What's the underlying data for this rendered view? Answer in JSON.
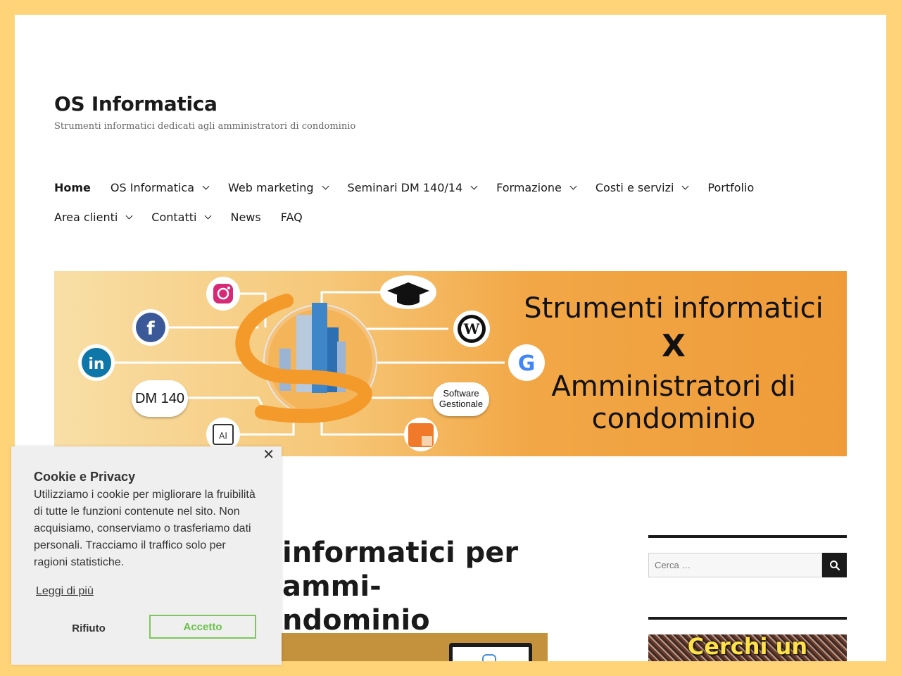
{
  "site": {
    "title": "OS Informatica",
    "description": "Strumenti informatici dedicati agli amministratori di condominio"
  },
  "menu": {
    "row1": [
      {
        "label": "Home",
        "current": true,
        "dropdown": false
      },
      {
        "label": "OS Informatica",
        "dropdown": true
      },
      {
        "label": "Web marketing",
        "dropdown": true
      },
      {
        "label": "Seminari DM 140/14",
        "dropdown": true
      },
      {
        "label": "Formazione",
        "dropdown": true
      },
      {
        "label": "Costi e servizi",
        "dropdown": true
      },
      {
        "label": "Portfolio",
        "dropdown": false
      }
    ],
    "row2": [
      {
        "label": "Area clienti",
        "dropdown": true
      },
      {
        "label": "Contatti",
        "dropdown": true
      },
      {
        "label": "News",
        "dropdown": false
      },
      {
        "label": "FAQ",
        "dropdown": false
      }
    ]
  },
  "banner": {
    "line1": "Strumenti informatici",
    "x": "X",
    "line2": "Amministratori di condominio",
    "bubble_dm": "DM 140",
    "bubble_software_1": "Software",
    "bubble_software_2": "Gestionale",
    "ai_label": "AI",
    "icons": [
      "instagram-icon",
      "facebook-icon",
      "linkedin-icon",
      "graduation-cap-icon",
      "wordpress-icon",
      "google-icon",
      "ai-chip-icon",
      "calculator-icon",
      "building-logo"
    ]
  },
  "post": {
    "title": "Strumenti informatici per amministratori di condominio",
    "title_visible": "informatici per ammi-\nndominio"
  },
  "sidebar": {
    "search_placeholder": "Cerca …",
    "ad_text": "Cerchi un"
  },
  "cookie": {
    "title": "Cookie e Privacy",
    "text": "Utilizziamo i cookie per migliorare la fruibilità di tutte le funzioni contenute nel sito. Non acquisiamo, conserviamo o trasferiamo dati personali. Tracciamo il traffico solo per ragioni statistiche.",
    "more_link": "Leggi di più",
    "reject_label": "Rifiuto",
    "accept_label": "Accetto",
    "close_glyph": "✕"
  },
  "colors": {
    "frame": "#ffd479",
    "text": "#1a1a1a",
    "accept_green": "#6abf4b",
    "banner_orange": "#ef9b39"
  }
}
